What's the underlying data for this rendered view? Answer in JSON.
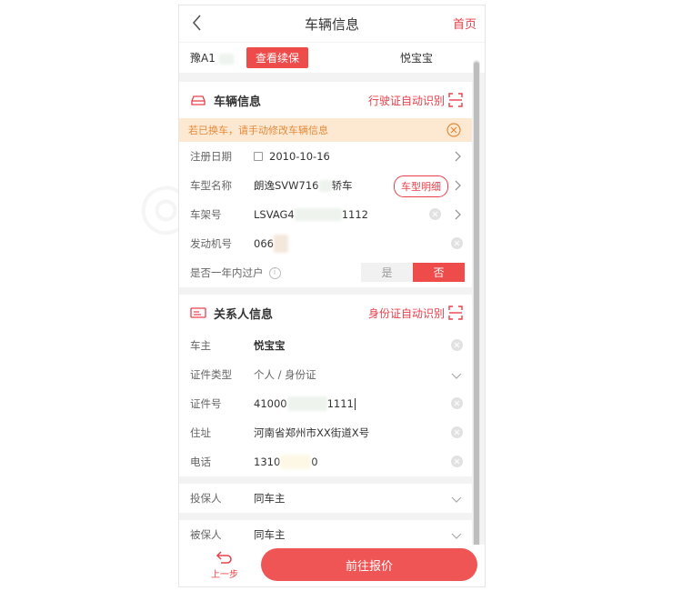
{
  "header": {
    "title": "车辆信息",
    "home_label": "首页"
  },
  "plate_row": {
    "plate_prefix": "豫A1",
    "renew_button": "查看续保",
    "owner_name": "悦宝宝"
  },
  "vehicle_section": {
    "title": "车辆信息",
    "scan_action": "行驶证自动识别",
    "notice": "若已换车，请手动修改车辆信息",
    "fields": {
      "reg_date_label": "注册日期",
      "reg_date_value": "2010-10-16",
      "model_label": "车型名称",
      "model_value_start": "朗逸SVW716",
      "model_value_end": "轿车",
      "model_detail_button": "车型明细",
      "vin_label": "车架号",
      "vin_value_start": "LSVAG4",
      "vin_value_end": "1112",
      "engine_label": "发动机号",
      "engine_value": "066",
      "transfer_label": "是否一年内过户",
      "transfer_yes": "是",
      "transfer_no": "否"
    }
  },
  "contact_section": {
    "title": "关系人信息",
    "scan_action": "身份证自动识别",
    "fields": {
      "owner_label": "车主",
      "owner_value": "悦宝宝",
      "id_type_label": "证件类型",
      "id_type_value": "个人 / 身份证",
      "id_no_label": "证件号",
      "id_no_start": "41000",
      "id_no_end": "1111",
      "address_label": "住址",
      "address_value": "河南省郑州市XX街道X号",
      "phone_label": "电话",
      "phone_start": "1310",
      "phone_end": "0"
    }
  },
  "insured_rows": {
    "policyholder_label": "投保人",
    "policyholder_value": "同车主",
    "insured_label": "被保人",
    "insured_value": "同车主"
  },
  "footer": {
    "prev_label": "上一步",
    "quote_button": "前往报价"
  },
  "colors": {
    "accent": "#e8404b",
    "button": "#ef5555",
    "notice_bg": "#fde9d2",
    "notice_text": "#e58a3a"
  },
  "icons": [
    "back-arrow-icon",
    "car-icon",
    "scan-icon",
    "close-circle-icon",
    "calendar-icon",
    "chevron-right-icon",
    "clear-icon",
    "info-icon",
    "id-card-icon",
    "chevron-down-icon",
    "undo-arrow-icon"
  ]
}
